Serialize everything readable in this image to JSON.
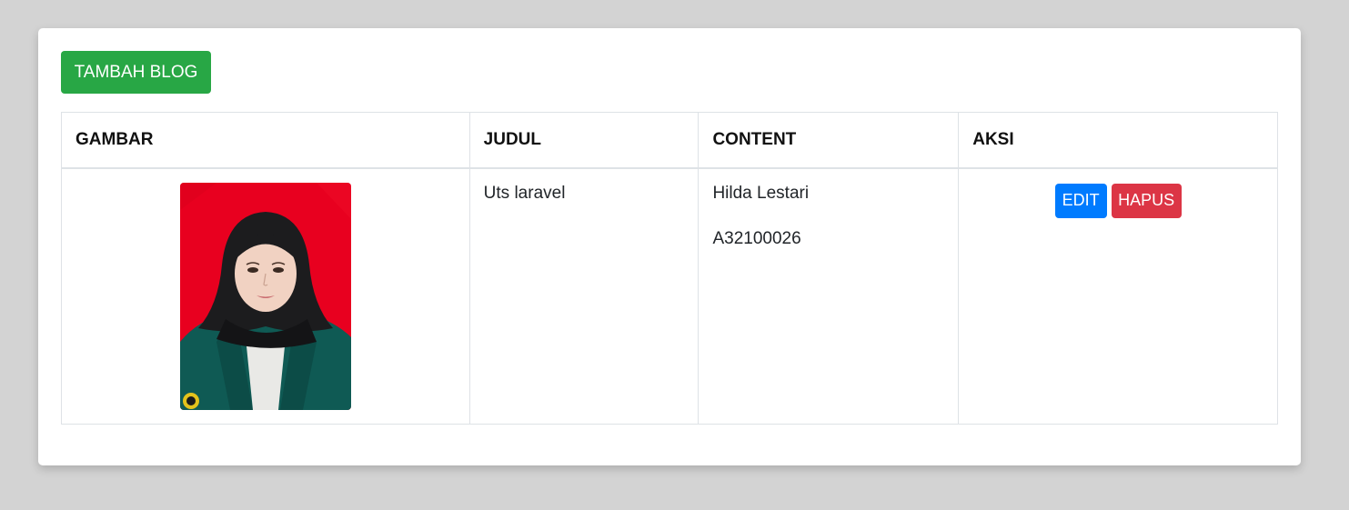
{
  "toolbar": {
    "add_label": "TAMBAH BLOG"
  },
  "table": {
    "headers": [
      "GAMBAR",
      "JUDUL",
      "CONTENT",
      "AKSI"
    ],
    "rows": [
      {
        "title": "Uts laravel",
        "content": [
          "Hilda Lestari",
          "A32100026"
        ],
        "actions": {
          "edit": "EDIT",
          "delete": "HAPUS"
        }
      }
    ]
  },
  "colors": {
    "add": "#28a745",
    "edit": "#007bff",
    "delete": "#dc3545",
    "photo_background": "#e8001f"
  }
}
